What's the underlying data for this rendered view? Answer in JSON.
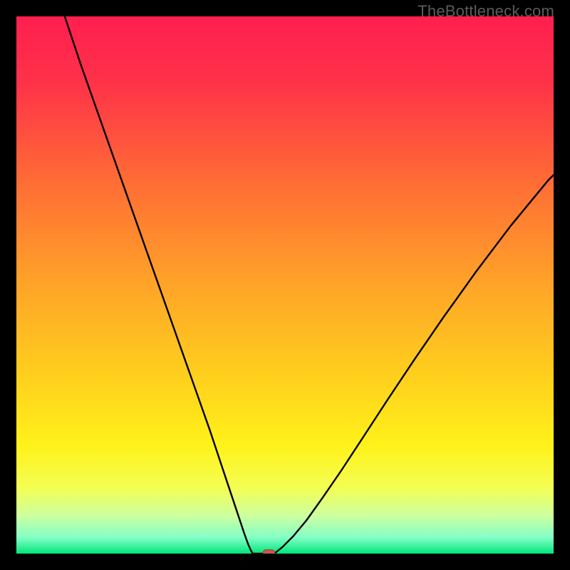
{
  "watermark": "TheBottleneck.com",
  "colors": {
    "frame": "#000000",
    "gradient_stops": [
      {
        "offset": 0.0,
        "color": "#ff1f4f"
      },
      {
        "offset": 0.12,
        "color": "#ff3149"
      },
      {
        "offset": 0.3,
        "color": "#ff6a36"
      },
      {
        "offset": 0.5,
        "color": "#ffa428"
      },
      {
        "offset": 0.68,
        "color": "#ffd21c"
      },
      {
        "offset": 0.8,
        "color": "#fff21a"
      },
      {
        "offset": 0.88,
        "color": "#f3ff56"
      },
      {
        "offset": 0.93,
        "color": "#ccffa0"
      },
      {
        "offset": 0.97,
        "color": "#83ffc6"
      },
      {
        "offset": 1.0,
        "color": "#00e67a"
      }
    ],
    "curve": "#000000",
    "marker_fill": "#c55a4e",
    "marker_stroke": "#9c4038"
  },
  "chart_data": {
    "type": "line",
    "title": "",
    "xlabel": "",
    "ylabel": "",
    "xlim": [
      0,
      100
    ],
    "ylim": [
      0,
      100
    ],
    "grid": false,
    "legend": false,
    "series": [
      {
        "name": "left-branch",
        "x": [
          9,
          12,
          15,
          18,
          21,
          24,
          27,
          30,
          33,
          36,
          38,
          40,
          41.5,
          42.5,
          43.2,
          43.7,
          44.0
        ],
        "y": [
          100,
          91,
          82.5,
          74,
          65.5,
          57,
          48.5,
          40,
          31.5,
          23,
          17,
          11,
          6.5,
          3.5,
          1.6,
          0.5,
          0.0
        ]
      },
      {
        "name": "flat-bottom",
        "x": [
          44.0,
          48.0
        ],
        "y": [
          0.0,
          0.0
        ]
      },
      {
        "name": "right-branch",
        "x": [
          48.0,
          49.5,
          51.5,
          54,
          57,
          60.5,
          64.5,
          69,
          74,
          79.5,
          85.5,
          92,
          99,
          100
        ],
        "y": [
          0.0,
          1.2,
          3.2,
          6.2,
          10.4,
          15.5,
          21.6,
          28.5,
          36.0,
          44.0,
          52.4,
          61.0,
          69.5,
          70.5
        ]
      }
    ],
    "marker": {
      "name": "optimal-point",
      "x": 47.0,
      "y": 0.0,
      "shape": "rounded-rect"
    },
    "annotations": []
  }
}
